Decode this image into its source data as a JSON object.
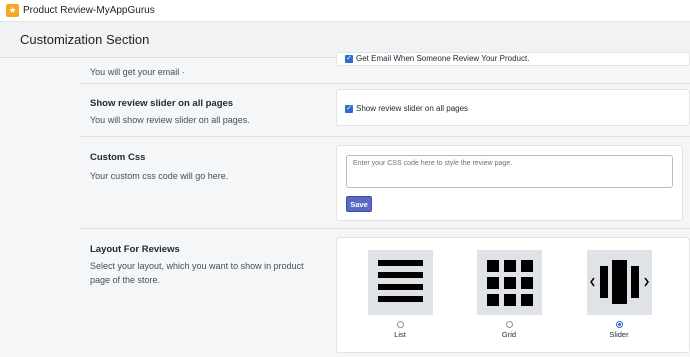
{
  "app": {
    "title": "Product Review-MyAppGurus",
    "icon": "star-icon"
  },
  "header": {
    "title": "Customization Section"
  },
  "settings": {
    "email": {
      "desc": "You will get your email ·",
      "checkbox_label": "Get Email When Someone Review Your Product.",
      "checked": true
    },
    "slider": {
      "title": "Show review slider on all pages",
      "desc": "You will show review slider on all pages.",
      "checkbox_label": "Show review slider on all pages",
      "checked": true
    },
    "css": {
      "title": "Custom Css",
      "desc": "Your custom css code will go here.",
      "placeholder": "Enter your CSS code here to style the review page.",
      "save_label": "Save"
    },
    "layout": {
      "title": "Layout For Reviews",
      "desc": "Select your layout, which you want to show in product page of the store.",
      "options": [
        {
          "label": "List",
          "icon": "list-layout-icon",
          "selected": false
        },
        {
          "label": "Grid",
          "icon": "grid-layout-icon",
          "selected": false
        },
        {
          "label": "Slider",
          "icon": "slider-layout-icon",
          "selected": true
        }
      ]
    }
  },
  "colors": {
    "accent": "#5c6ac4",
    "checkbox": "#2c6ecb"
  }
}
